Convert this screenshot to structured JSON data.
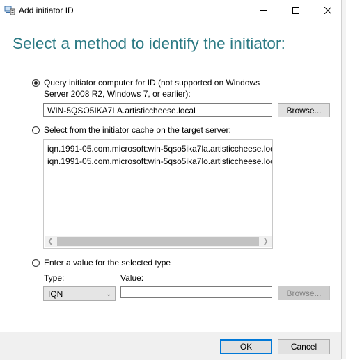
{
  "window": {
    "title": "Add initiator ID"
  },
  "headline": "Select a method to identify the initiator:",
  "query_option": {
    "label_line1": "Query initiator computer for ID (not supported on Windows",
    "label_line2": "Server 2008 R2, Windows 7, or earlier):",
    "selected": true,
    "computer_value": "WIN-5QSO5IKA7LA.artisticcheese.local",
    "browse_label": "Browse..."
  },
  "cache_option": {
    "label": "Select from the initiator cache on the target server:",
    "selected": false,
    "items": [
      "iqn.1991-05.com.microsoft:win-5qso5ika7la.artisticcheese.loc",
      "iqn.1991-05.com.microsoft:win-5qso5ika7lo.artisticcheese.loc"
    ]
  },
  "manual_option": {
    "label": "Enter a value for the selected type",
    "selected": false,
    "type_label": "Type:",
    "value_label": "Value:",
    "type_selected": "IQN",
    "value": "",
    "browse_label": "Browse..."
  },
  "footer": {
    "ok_label": "OK",
    "cancel_label": "Cancel"
  },
  "colors": {
    "headline": "#2c7a84",
    "accent": "#0078d7"
  }
}
